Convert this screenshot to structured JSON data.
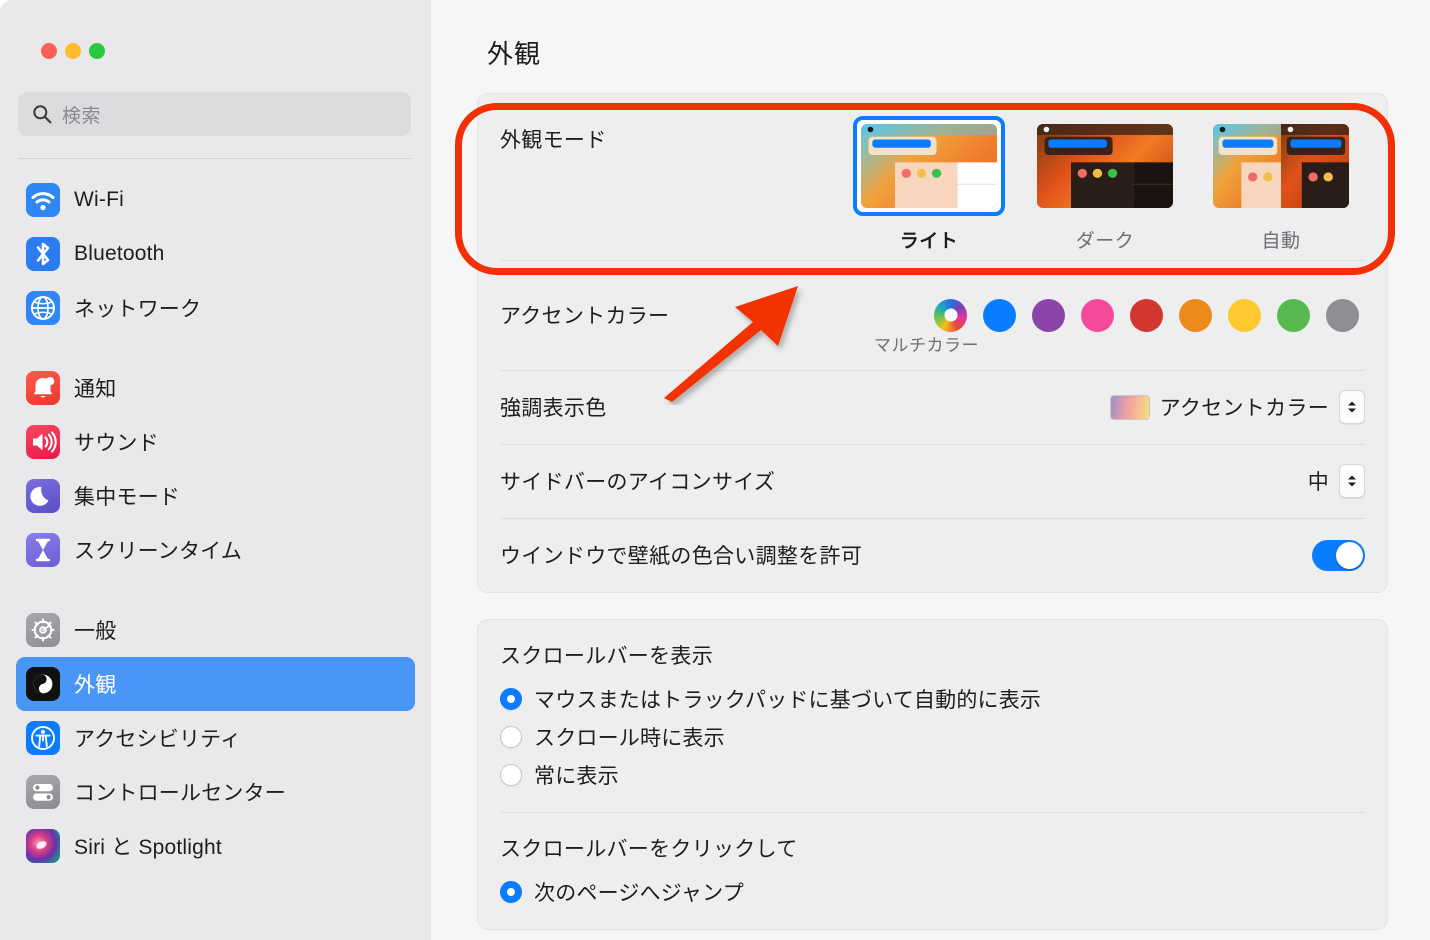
{
  "window": {
    "traffic_lights": [
      {
        "name": "close",
        "color": "#ff5f57"
      },
      {
        "name": "minimize",
        "color": "#febc2e"
      },
      {
        "name": "zoom",
        "color": "#28c840"
      }
    ]
  },
  "search": {
    "placeholder": "検索",
    "value": "",
    "icon": "search-icon"
  },
  "sidebar": {
    "groups": [
      {
        "items": [
          {
            "label": "Wi-Fi",
            "icon": "wifi-icon",
            "selected": false
          },
          {
            "label": "Bluetooth",
            "icon": "bluetooth-icon",
            "selected": false
          },
          {
            "label": "ネットワーク",
            "icon": "network-globe-icon",
            "selected": false
          }
        ]
      },
      {
        "items": [
          {
            "label": "通知",
            "icon": "bell-icon",
            "selected": false
          },
          {
            "label": "サウンド",
            "icon": "speaker-icon",
            "selected": false
          },
          {
            "label": "集中モード",
            "icon": "moon-icon",
            "selected": false
          },
          {
            "label": "スクリーンタイム",
            "icon": "hourglass-icon",
            "selected": false
          }
        ]
      },
      {
        "items": [
          {
            "label": "一般",
            "icon": "gear-icon",
            "selected": false
          },
          {
            "label": "外観",
            "icon": "appearance-icon",
            "selected": true
          },
          {
            "label": "アクセシビリティ",
            "icon": "accessibility-icon",
            "selected": false
          },
          {
            "label": "コントロールセンター",
            "icon": "control-center-icon",
            "selected": false
          },
          {
            "label": "Siri と Spotlight",
            "icon": "siri-icon",
            "selected": false
          }
        ]
      }
    ]
  },
  "main": {
    "page_title": "外観",
    "appearance_mode": {
      "label": "外観モード",
      "options": [
        {
          "name": "ライト",
          "selected": true
        },
        {
          "name": "ダーク",
          "selected": false
        },
        {
          "name": "自動",
          "selected": false
        }
      ]
    },
    "accent_color": {
      "label": "アクセントカラー",
      "caption": "マルチカラー",
      "swatches": [
        {
          "name": "マルチカラー",
          "color": "multicolor",
          "selected": true
        },
        {
          "name": "ブルー",
          "color": "#0a7cff",
          "selected": false
        },
        {
          "name": "パープル",
          "color": "#8b44a8",
          "selected": false
        },
        {
          "name": "ピンク",
          "color": "#f5499b",
          "selected": false
        },
        {
          "name": "レッド",
          "color": "#d2372f",
          "selected": false
        },
        {
          "name": "オレンジ",
          "color": "#ec8a1b",
          "selected": false
        },
        {
          "name": "イエロー",
          "color": "#fdc92f",
          "selected": false
        },
        {
          "name": "グリーン",
          "color": "#57b94e",
          "selected": false
        },
        {
          "name": "グラファイト",
          "color": "#8e8e93",
          "selected": false
        }
      ]
    },
    "highlight_color": {
      "label": "強調表示色",
      "value": "アクセントカラー"
    },
    "sidebar_icon_size": {
      "label": "サイドバーのアイコンサイズ",
      "value": "中"
    },
    "allow_wallpaper_tinting": {
      "label": "ウインドウで壁紙の色合い調整を許可",
      "value": "on"
    },
    "show_scroll_bars": {
      "title": "スクロールバーを表示",
      "options": [
        {
          "label": "マウスまたはトラックパッドに基づいて自動的に表示",
          "checked": true
        },
        {
          "label": "スクロール時に表示",
          "checked": false
        },
        {
          "label": "常に表示",
          "checked": false
        }
      ]
    },
    "click_scroll_bar": {
      "title": "スクロールバーをクリックして",
      "options": [
        {
          "label": "次のページへジャンプ",
          "checked": true
        }
      ]
    }
  },
  "annotations": {
    "highlight_color": "#f23005",
    "rect_target": "外観モード",
    "arrow_target": "アクセントカラー"
  }
}
